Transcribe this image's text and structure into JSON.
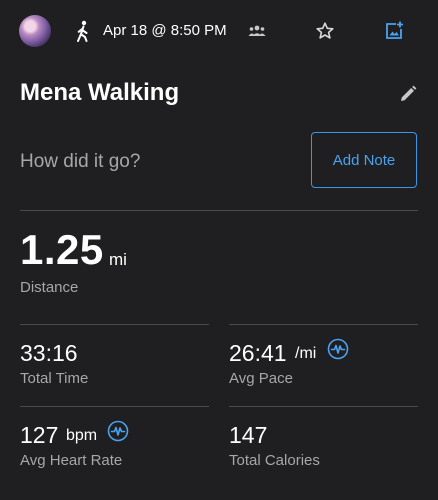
{
  "header": {
    "datetime": "Apr 18 @ 8:50 PM",
    "icons": [
      "avatar",
      "walking-icon",
      "group-icon",
      "star-icon",
      "add-photo-icon"
    ]
  },
  "activity": {
    "title": "Mena Walking",
    "prompt": "How did it go?",
    "add_note_label": "Add Note"
  },
  "distance": {
    "value": "1.25",
    "unit": "mi",
    "label": "Distance"
  },
  "stats": {
    "total_time": {
      "value": "33:16",
      "label": "Total Time"
    },
    "avg_pace": {
      "value": "26:41",
      "unit": "/mi",
      "label": "Avg Pace"
    },
    "avg_heart_rate": {
      "value": "127",
      "unit": "bpm",
      "label": "Avg Heart Rate"
    },
    "total_calories": {
      "value": "147",
      "label": "Total Calories"
    }
  },
  "colors": {
    "background": "#1f1e20",
    "accent": "#3c95e6",
    "text_secondary": "#a7a7aa",
    "divider": "#4a494c"
  }
}
